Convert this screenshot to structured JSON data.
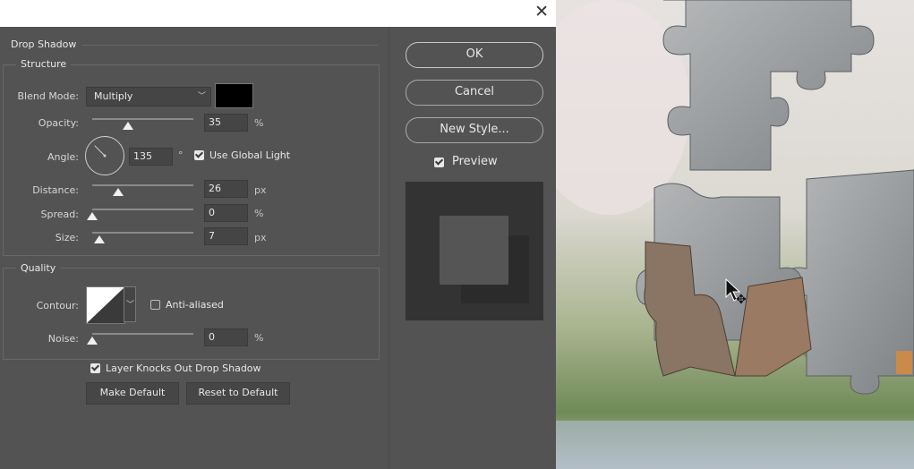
{
  "dialog": {
    "close_glyph": "✕",
    "section_title": "Drop Shadow",
    "structure": {
      "legend": "Structure",
      "blend_mode_label": "Blend Mode:",
      "blend_mode_value": "Multiply",
      "shadow_color": "#000000",
      "opacity_label": "Opacity:",
      "opacity_value": "35",
      "opacity_unit": "%",
      "opacity_fraction": 0.35,
      "angle_label": "Angle:",
      "angle_value": "135",
      "angle_unit": "°",
      "use_global_light_label": "Use Global Light",
      "use_global_light": true,
      "distance_label": "Distance:",
      "distance_value": "26",
      "distance_unit": "px",
      "distance_fraction": 0.26,
      "spread_label": "Spread:",
      "spread_value": "0",
      "spread_unit": "%",
      "spread_fraction": 0.0,
      "size_label": "Size:",
      "size_value": "7",
      "size_unit": "px",
      "size_fraction": 0.07
    },
    "quality": {
      "legend": "Quality",
      "contour_label": "Contour:",
      "anti_aliased_label": "Anti-aliased",
      "anti_aliased": false,
      "noise_label": "Noise:",
      "noise_value": "0",
      "noise_unit": "%",
      "noise_fraction": 0.0
    },
    "layer_knocks_out_label": "Layer Knocks Out Drop Shadow",
    "layer_knocks_out": true,
    "make_default_label": "Make Default",
    "reset_default_label": "Reset to Default"
  },
  "side": {
    "ok_label": "OK",
    "cancel_label": "Cancel",
    "new_style_label": "New Style...",
    "preview_label": "Preview",
    "preview_checked": true
  },
  "colors": {
    "dialog_bg": "#535353",
    "preview_bg": "#333333",
    "preview_swatch": "#555555",
    "preview_shadow": "#2b2b2b"
  }
}
